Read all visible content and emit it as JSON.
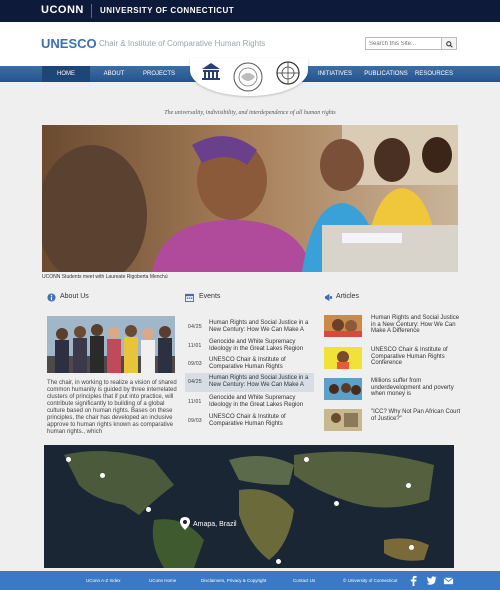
{
  "topbar": {
    "logo": "UCONN",
    "university": "UNIVERSITY OF CONNECTICUT"
  },
  "header": {
    "brand": "UNESCO",
    "subtitle": "Chair & Institute of Comparative Human Rights"
  },
  "search": {
    "placeholder": "Search this Site...",
    "button_icon": "search-icon"
  },
  "nav": {
    "items": [
      {
        "label": "HOME",
        "active": true
      },
      {
        "label": "ABOUT"
      },
      {
        "label": "PROJECTS"
      },
      {
        "label": "INITIATIVES"
      },
      {
        "label": "PUBLICATIONS"
      },
      {
        "label": "RESOURCES"
      }
    ]
  },
  "tagline": "The universality, indivisibility, and interdependence of all human rights",
  "hero": {
    "caption": "UCONN Students meet with Laureate Rigoberta Menchú"
  },
  "about": {
    "title": "About Us",
    "text": "The chair, in working to realize a vision of shared common humanity is guided by three interrelated clusters of principles that if put into practice, will contribute significantly to building of a global culture based on human rights. Bases on these principles, the chair has developed an inclusive approve to human rights known as comparative human rights., which"
  },
  "events": {
    "title": "Events",
    "items": [
      {
        "date": "04/25",
        "title": "Human Rights and Social Justice in a New Century: How We Can Make A"
      },
      {
        "date": "11/01",
        "title": "Genocide and White Supremacy Ideology in the Great Lakes Region"
      },
      {
        "date": "09/03",
        "title": "UNESCO Chair & Institute of Comparative Human Rights"
      },
      {
        "date": "04/25",
        "title": "Human Rights and Social Justice in a New Century: How We Can Make A"
      },
      {
        "date": "11/01",
        "title": "Genocide and White Supremacy Ideology in the Great Lakes Region"
      },
      {
        "date": "09/03",
        "title": "UNESCO Chair & Institute of Comparative Human Rights"
      }
    ]
  },
  "articles": {
    "title": "Articles",
    "items": [
      {
        "title": "Human Rights and Social Justice in a New Century: How We Can Make A Difference"
      },
      {
        "title": "UNESCO Chair & Institute of Comparative Human Rights Conference"
      },
      {
        "title": "Millions suffer from underdevelopment and poverty when money is"
      },
      {
        "title": "\"ICC? Why Not Pan African Court of Justice?\""
      }
    ]
  },
  "map": {
    "label": "Amapa, Brazil"
  },
  "footer": {
    "links": [
      "UConn A-Z Index",
      "UConn Home",
      "Disclaimers, Privacy & Copyright",
      "Contact Us",
      "© University of Connecticut"
    ],
    "social": [
      "facebook-icon",
      "twitter-icon",
      "email-icon"
    ]
  },
  "colors": {
    "navy": "#0e1a3a",
    "accent": "#3d6fb2",
    "nav": "#2c5f99",
    "footer": "#3a79c6"
  }
}
